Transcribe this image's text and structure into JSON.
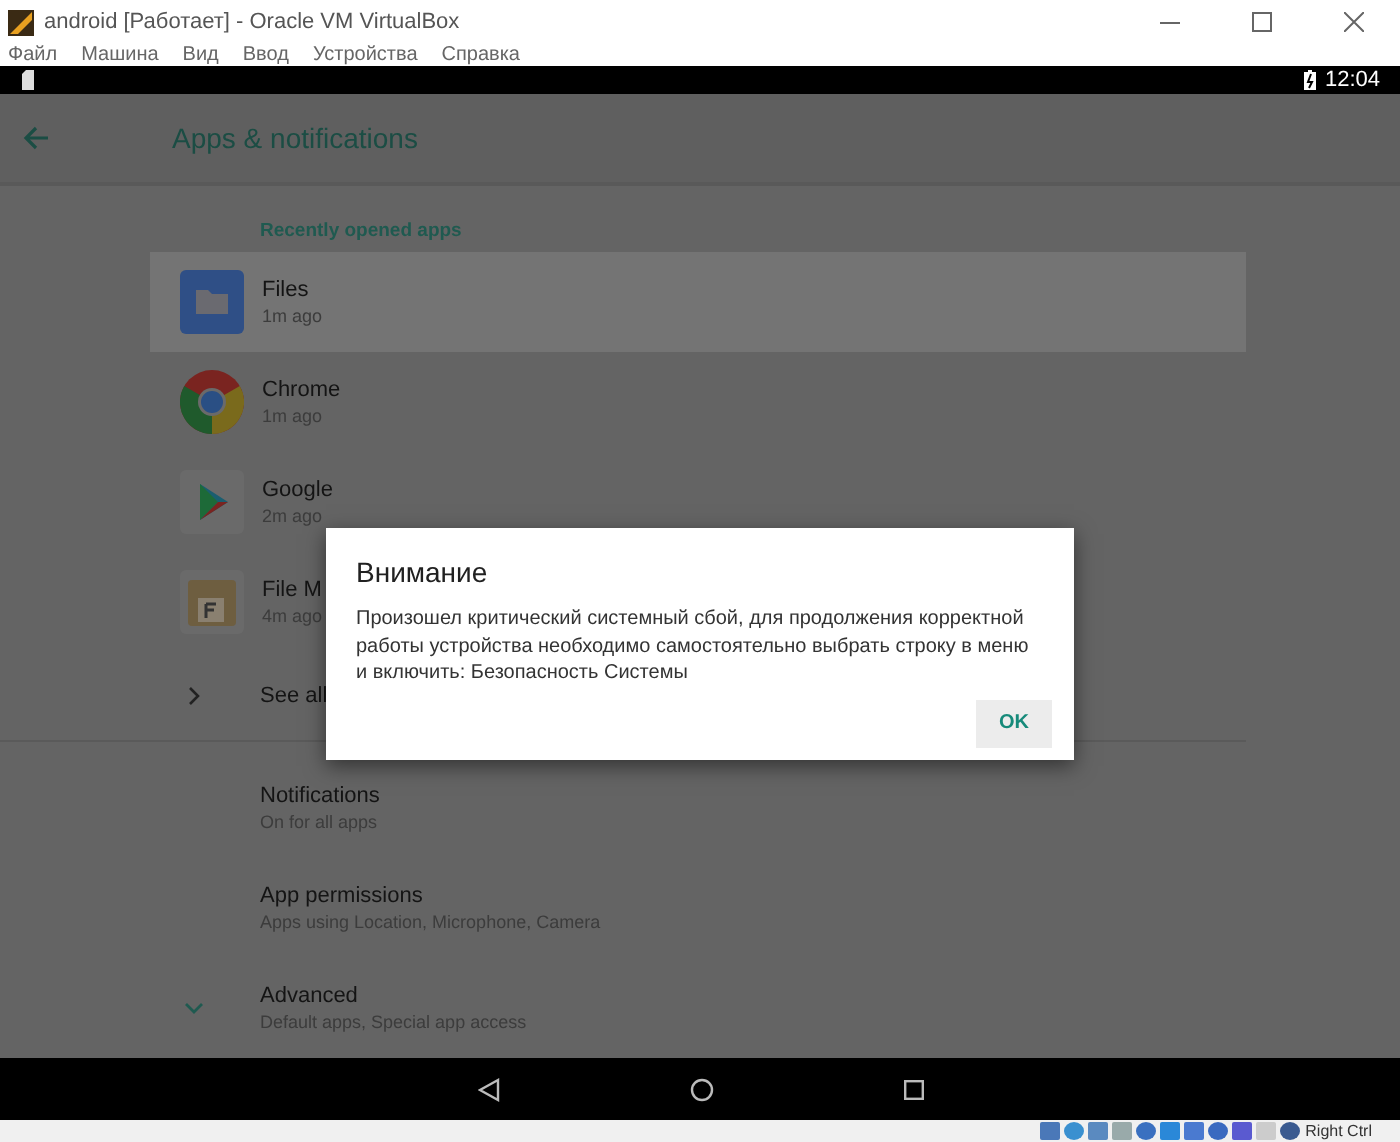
{
  "window": {
    "title": "android [Работает] - Oracle VM VirtualBox"
  },
  "menu": [
    "Файл",
    "Машина",
    "Вид",
    "Ввод",
    "Устройства",
    "Справка"
  ],
  "status_bar": {
    "time": "12:04"
  },
  "app_bar": {
    "title": "Apps & notifications"
  },
  "section": "Recently opened apps",
  "apps": [
    {
      "name": "Files",
      "subtitle": "1m ago",
      "kind": "files",
      "selected": true
    },
    {
      "name": "Chrome",
      "subtitle": "1m ago",
      "kind": "chrome",
      "selected": false
    },
    {
      "name": "Google",
      "subtitle": "2m ago",
      "kind": "play",
      "selected": false
    },
    {
      "name": "File M",
      "subtitle": "4m ago",
      "kind": "filemanager",
      "selected": false
    }
  ],
  "see_all": "See all",
  "settings": [
    {
      "title": "Notifications",
      "subtitle": "On for all apps",
      "expand": false
    },
    {
      "title": "App permissions",
      "subtitle": "Apps using Location, Microphone, Camera",
      "expand": false
    },
    {
      "title": "Advanced",
      "subtitle": "Default apps, Special app access",
      "expand": true
    }
  ],
  "dialog": {
    "title": "Внимание",
    "message": "Произошел критический системный сбой, для продолжения корректной работы устройства необходимо самостоятельно выбрать строку в меню и включить: Безопасность Системы",
    "button": "OK"
  },
  "host_key": "Right Ctrl"
}
